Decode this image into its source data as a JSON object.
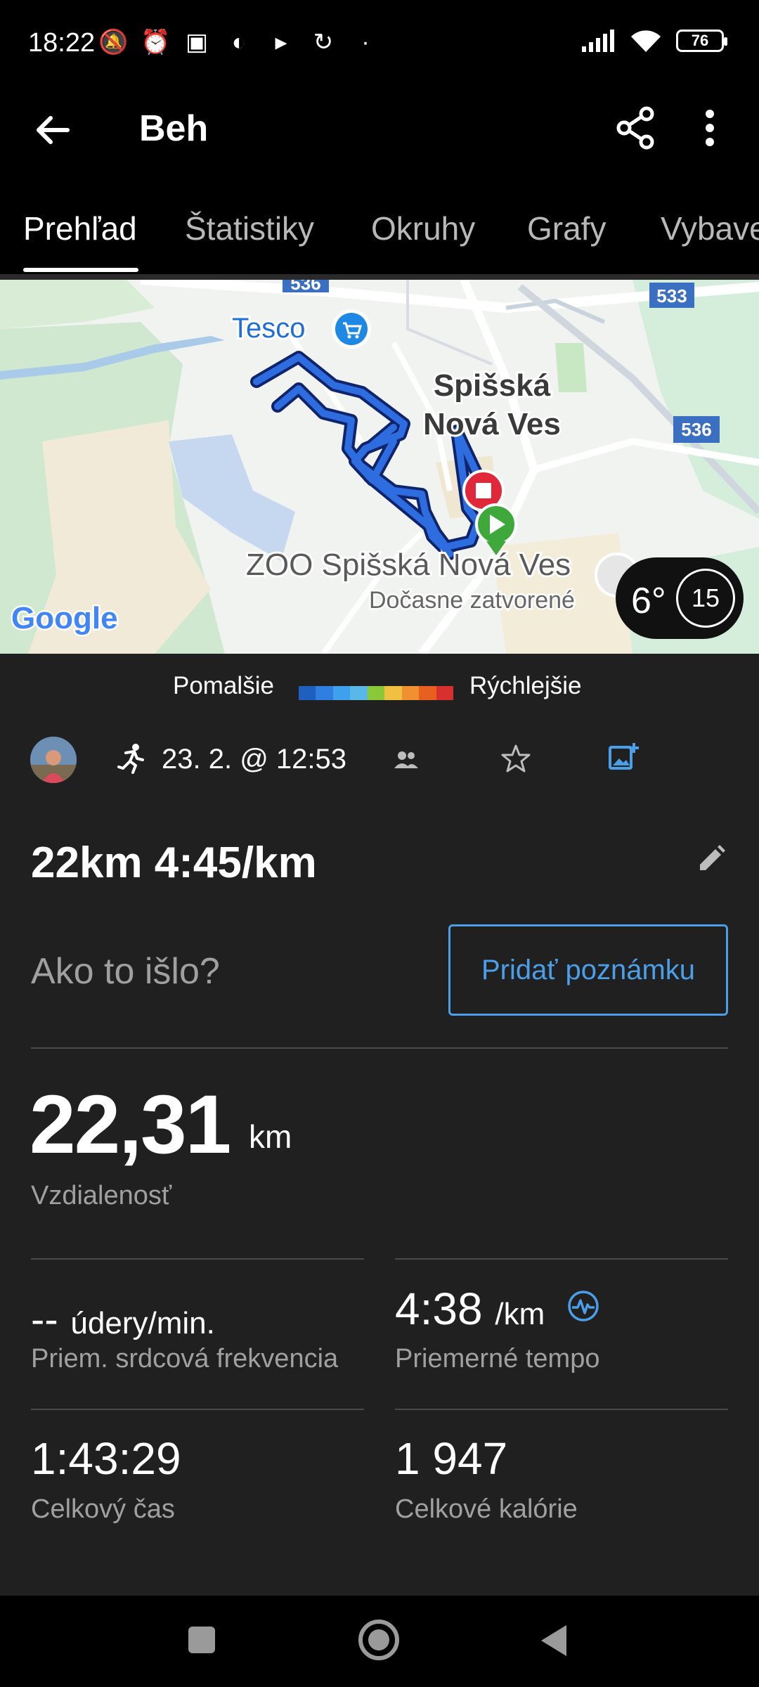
{
  "status_bar": {
    "time": "18:22",
    "battery": "76",
    "left_icons": [
      "mute-bell-icon",
      "alarm-icon",
      "nfc-icon",
      "messenger-icon",
      "play-icon",
      "sync-icon",
      "dot-icon"
    ],
    "right_icons": [
      "signal-icon",
      "wifi-icon",
      "battery-icon"
    ]
  },
  "app_bar": {
    "title": "Beh"
  },
  "tabs": [
    {
      "label": "Prehľad",
      "active": true
    },
    {
      "label": "Štatistiky",
      "active": false
    },
    {
      "label": "Okruhy",
      "active": false
    },
    {
      "label": "Grafy",
      "active": false
    },
    {
      "label": "Vybave",
      "active": false
    }
  ],
  "map": {
    "labels": {
      "tesco": "Tesco",
      "city_line1": "Spišská",
      "city_line2": "Nová Ves",
      "zoo": "ZOO Spišská Nová Ves",
      "zoo_status": "Dočasne zatvorené",
      "road_536_top": "536",
      "road_533": "533",
      "road_536_right": "536",
      "google": "Google"
    },
    "weather": {
      "temperature": "6°",
      "wind": "15"
    }
  },
  "legend": {
    "slower": "Pomalšie",
    "faster": "Rýchlejšie",
    "colors": [
      "#1f5fbf",
      "#2f7fe0",
      "#3fa0ee",
      "#59b8e8",
      "#8ac83a",
      "#f0c040",
      "#f09030",
      "#e8601f",
      "#d8302f"
    ]
  },
  "activity": {
    "date": "23. 2. @ 12:53",
    "name": "22km 4:45/km",
    "how_prompt": "Ako to išlo?",
    "add_note": "Pridať poznámku"
  },
  "stats": {
    "distance": {
      "value": "22,31",
      "unit": "km",
      "label": "Vzdialenosť"
    },
    "heart_rate": {
      "value": "--",
      "unit": "údery/min.",
      "label": "Priem. srdcová frekvencia"
    },
    "pace": {
      "value": "4:38",
      "unit": "/km",
      "label": "Priemerné tempo"
    },
    "time": {
      "value": "1:43:29",
      "label": "Celkový čas"
    },
    "calories": {
      "value": "1 947",
      "label": "Celkové kalórie"
    }
  }
}
